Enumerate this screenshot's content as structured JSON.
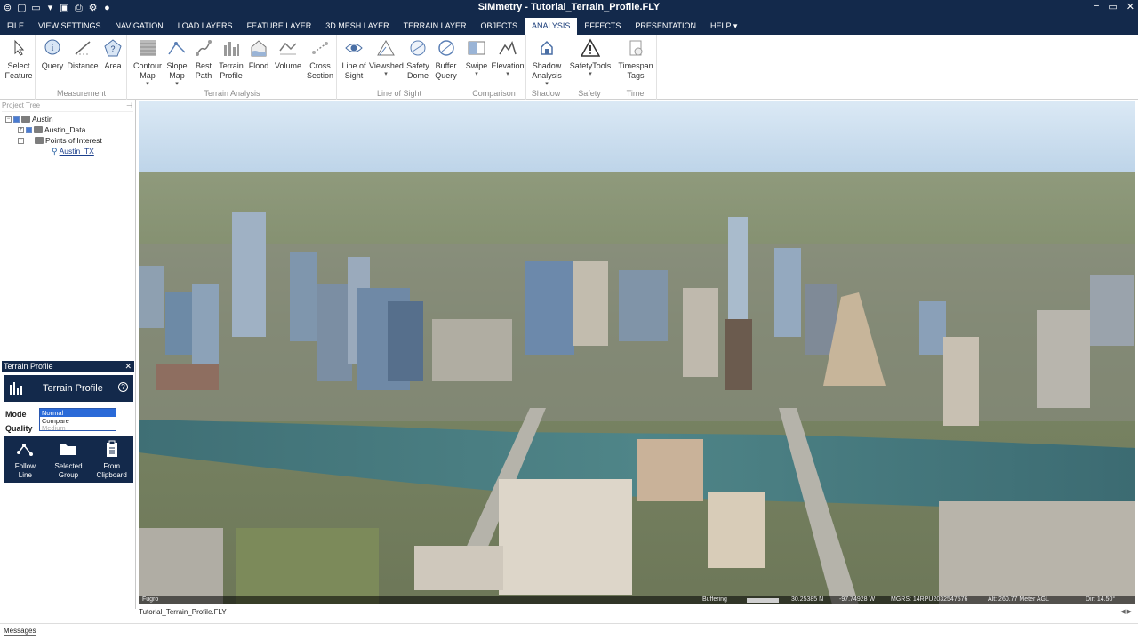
{
  "app": {
    "title": "SIMmetry - Tutorial_Terrain_Profile.FLY",
    "controls": [
      "−",
      "▭",
      "✕"
    ]
  },
  "menu": [
    "FILE",
    "VIEW SETTINGS",
    "NAVIGATION",
    "LOAD LAYERS",
    "FEATURE LAYER",
    "3D MESH LAYER",
    "TERRAIN LAYER",
    "OBJECTS",
    "ANALYSIS",
    "EFFECTS",
    "PRESENTATION",
    "HELP ▾"
  ],
  "menu_active": "ANALYSIS",
  "ribbon": {
    "select_feature": [
      "Select",
      "Feature"
    ],
    "measurement": {
      "label": "Measurement",
      "query": "Query",
      "distance": "Distance",
      "area": "Area"
    },
    "terrain_analysis": {
      "label": "Terrain Analysis",
      "contour": [
        "Contour",
        "Map"
      ],
      "slope": [
        "Slope",
        "Map"
      ],
      "best_path": [
        "Best",
        "Path"
      ],
      "terrain_profile": [
        "Terrain",
        "Profile"
      ],
      "flood": "Flood",
      "volume": "Volume",
      "cross_section": [
        "Cross",
        "Section"
      ]
    },
    "line_of_sight": {
      "label": "Line of Sight",
      "los": [
        "Line of",
        "Sight"
      ],
      "viewshed": "Viewshed",
      "safety_dome": [
        "Safety",
        "Dome"
      ],
      "buffer_query": [
        "Buffer",
        "Query"
      ]
    },
    "comparison": {
      "label": "Comparison",
      "swipe": "Swipe",
      "elevation": "Elevation"
    },
    "shadow": {
      "label": "Shadow",
      "shadow_analysis": [
        "Shadow",
        "Analysis"
      ]
    },
    "safety": {
      "label": "Safety",
      "safety_tools": "SafetyTools"
    },
    "time": {
      "label": "Time",
      "timespan": [
        "Timespan",
        "Tags"
      ]
    }
  },
  "project_tree": {
    "header": "Project Tree",
    "nodes": [
      "Austin",
      "Austin_Data",
      "Points of Interest",
      "Austin_TX"
    ]
  },
  "terrain_profile": {
    "panel_title": "Terrain Profile",
    "heading": "Terrain Profile",
    "mode_label": "Mode",
    "quality_label": "Quality",
    "mode_options": [
      "Normal",
      "Compare",
      "Medium"
    ],
    "mode_selected": "Normal",
    "actions": [
      [
        "Follow",
        "Line"
      ],
      [
        "Selected",
        "Group"
      ],
      [
        "From",
        "Clipboard"
      ]
    ]
  },
  "status": {
    "attribution": "Fugro",
    "buffering": "Buffering",
    "lat": "30.25385 N",
    "lon": "-97.74928 W",
    "mgrs": "MGRS: 14RPU2032547576",
    "alt": "Alt: 260.77 Meter AGL",
    "dir": "Dir: 14.50°"
  },
  "command_line": "Tutorial_Terrain_Profile.FLY",
  "messages_tab": "Messages",
  "colors": {
    "brand_navy": "#13294b",
    "accent_blue": "#2a6ad8"
  }
}
